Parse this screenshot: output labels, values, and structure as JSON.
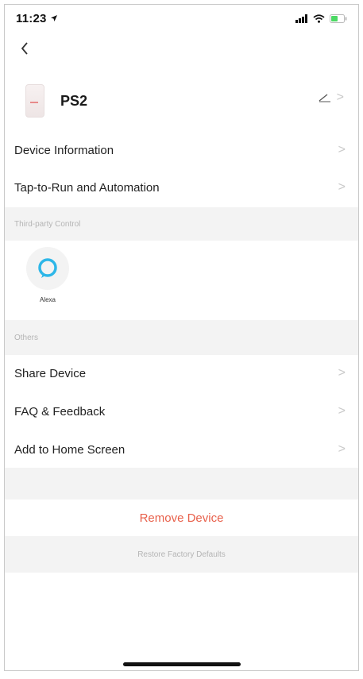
{
  "status_bar": {
    "time": "11:23"
  },
  "device": {
    "name": "PS2"
  },
  "menu_top": [
    {
      "label": "Device Information",
      "chevron": ">"
    },
    {
      "label": "Tap-to-Run and Automation",
      "chevron": ">"
    }
  ],
  "third_party": {
    "header": "Third-party Control",
    "items": [
      {
        "label": "Alexa",
        "icon": "alexa-icon"
      }
    ]
  },
  "others": {
    "header": "Others",
    "items": [
      {
        "label": "Share Device",
        "chevron": ">"
      },
      {
        "label": "FAQ & Feedback",
        "chevron": ">"
      },
      {
        "label": "Add to Home Screen",
        "chevron": ">"
      }
    ]
  },
  "actions": {
    "remove": "Remove Device",
    "restore": "Restore Factory Defaults"
  },
  "colors": {
    "accent_remove": "#e8604b",
    "alexa_blue": "#2eb7e8",
    "section_bg": "#f3f3f3",
    "battery_green": "#4cd964"
  }
}
